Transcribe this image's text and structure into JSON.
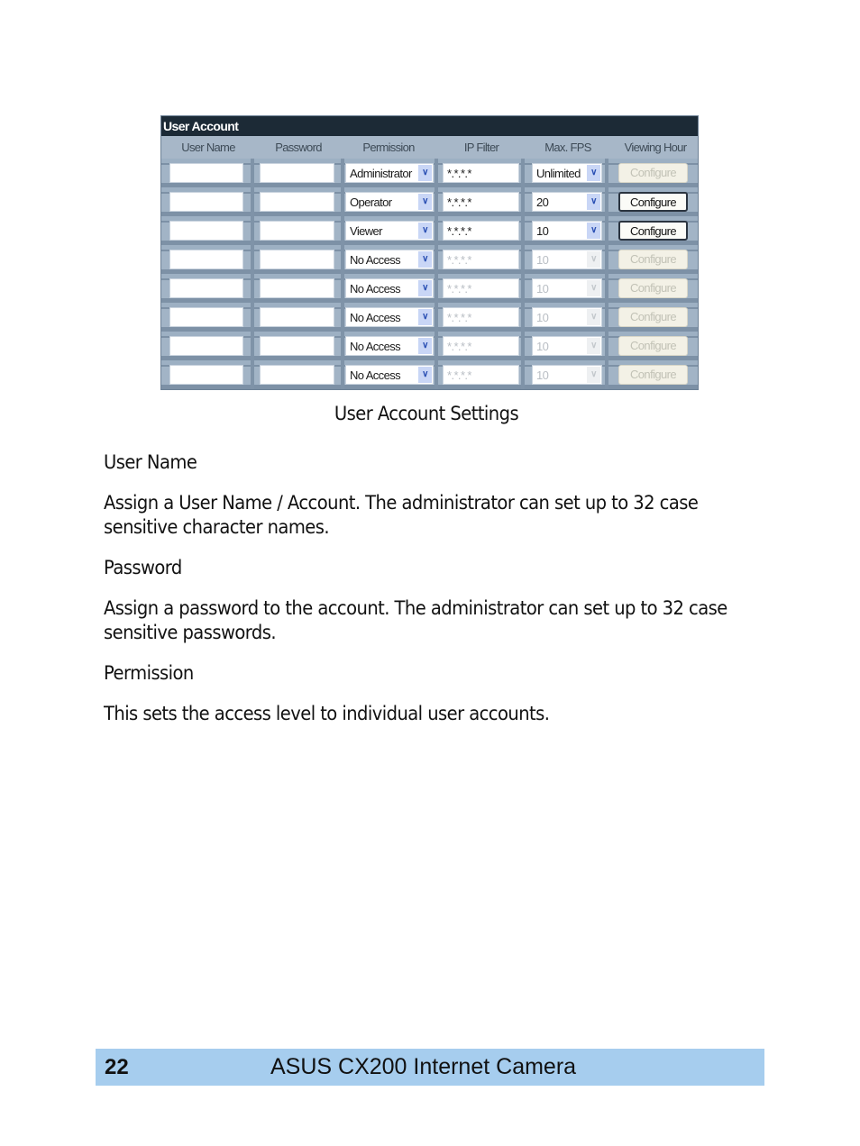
{
  "panel": {
    "title": "User Account",
    "columns": [
      "User Name",
      "Password",
      "Permission",
      "IP Filter",
      "Max. FPS",
      "Viewing Hour"
    ],
    "rows": [
      {
        "user_name": "",
        "password": "",
        "permission": "Administrator",
        "ip_filter": "*.*.*.*",
        "max_fps": "Unlimited",
        "viewing_hour": "Configure",
        "enabled": false,
        "fields_enabled": true
      },
      {
        "user_name": "",
        "password": "",
        "permission": "Operator",
        "ip_filter": "*.*.*.*",
        "max_fps": "20",
        "viewing_hour": "Configure",
        "enabled": true,
        "fields_enabled": true
      },
      {
        "user_name": "",
        "password": "",
        "permission": "Viewer",
        "ip_filter": "*.*.*.*",
        "max_fps": "10",
        "viewing_hour": "Configure",
        "enabled": true,
        "fields_enabled": true
      },
      {
        "user_name": "",
        "password": "",
        "permission": "No Access",
        "ip_filter": "*.*.*.*",
        "max_fps": "10",
        "viewing_hour": "Configure",
        "enabled": false,
        "fields_enabled": false
      },
      {
        "user_name": "",
        "password": "",
        "permission": "No Access",
        "ip_filter": "*.*.*.*",
        "max_fps": "10",
        "viewing_hour": "Configure",
        "enabled": false,
        "fields_enabled": false
      },
      {
        "user_name": "",
        "password": "",
        "permission": "No Access",
        "ip_filter": "*.*.*.*",
        "max_fps": "10",
        "viewing_hour": "Configure",
        "enabled": false,
        "fields_enabled": false
      },
      {
        "user_name": "",
        "password": "",
        "permission": "No Access",
        "ip_filter": "*.*.*.*",
        "max_fps": "10",
        "viewing_hour": "Configure",
        "enabled": false,
        "fields_enabled": false
      },
      {
        "user_name": "",
        "password": "",
        "permission": "No Access",
        "ip_filter": "*.*.*.*",
        "max_fps": "10",
        "viewing_hour": "Configure",
        "enabled": false,
        "fields_enabled": false
      }
    ]
  },
  "caption": "User Account Settings",
  "sections": [
    {
      "heading": "User Name",
      "body": "Assign a User Name / Account. The administrator can set up to 32 case sensitive character names."
    },
    {
      "heading": "Password",
      "body": "Assign a password to the account. The administrator can set up to 32 case sensitive passwords."
    },
    {
      "heading": "Permission",
      "body": "This sets the access level to individual user accounts."
    }
  ],
  "footer": {
    "page_number": "22",
    "title": "ASUS CX200 Internet Camera",
    "color": "#a6cdee"
  }
}
